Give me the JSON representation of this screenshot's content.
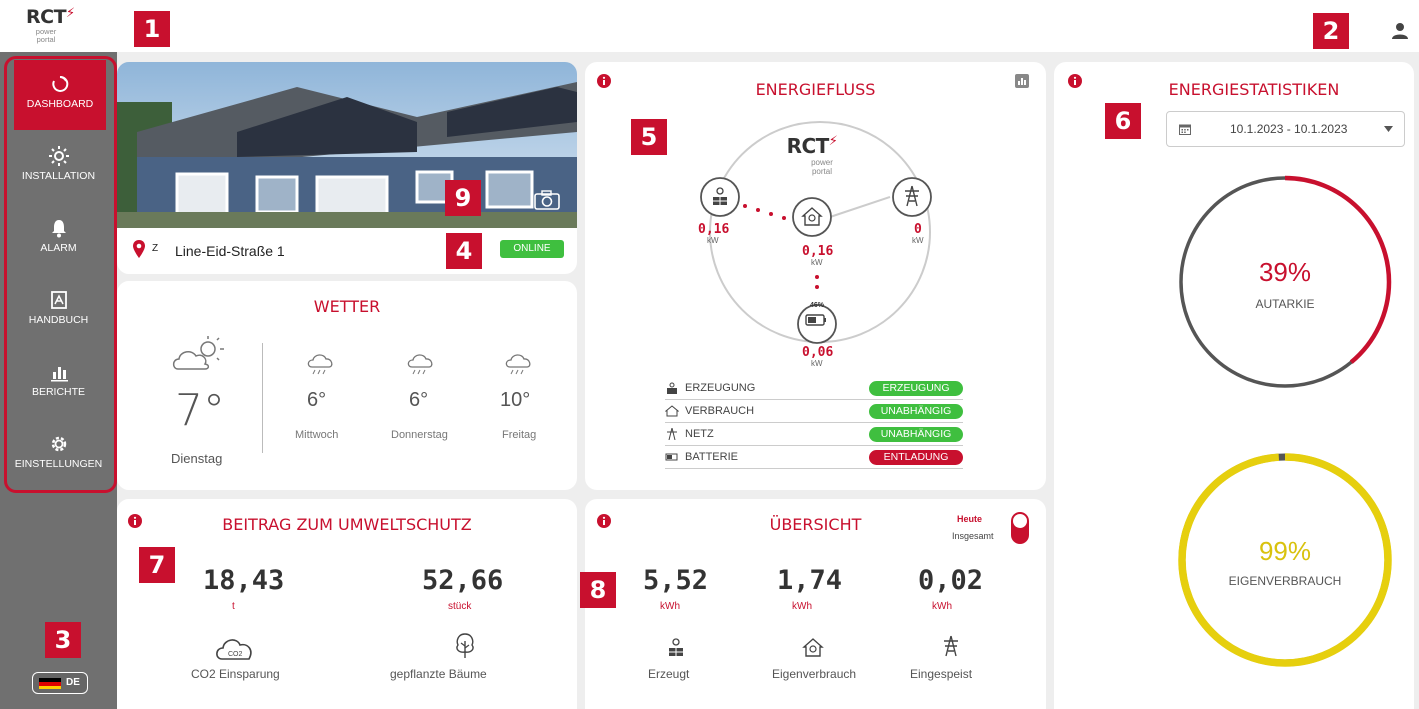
{
  "header": {
    "logo": {
      "brand": "RCT",
      "sub1": "power",
      "sub2": "portal"
    }
  },
  "badges": {
    "b1": "1",
    "b2": "2",
    "b3": "3",
    "b4": "4",
    "b5": "5",
    "b6": "6",
    "b7": "7",
    "b8": "8",
    "b9": "9"
  },
  "sidebar": {
    "items": [
      {
        "label": "DASHBOARD",
        "icon": "dashboard-icon"
      },
      {
        "label": "INSTALLATION",
        "icon": "sun-icon"
      },
      {
        "label": "ALARM",
        "icon": "bell-icon"
      },
      {
        "label": "HANDBUCH",
        "icon": "pdf-icon"
      },
      {
        "label": "BERICHTE",
        "icon": "chart-icon"
      },
      {
        "label": "EINSTELLUNGEN",
        "icon": "gear-icon"
      }
    ],
    "language": "DE"
  },
  "installation": {
    "address_prefix": "Z",
    "address": "Line-Eid-Straße 1",
    "status": "ONLINE"
  },
  "weather": {
    "title": "WETTER",
    "today": {
      "temp": "7°",
      "day": "Dienstag"
    },
    "forecast": [
      {
        "temp": "6°",
        "day": "Mittwoch"
      },
      {
        "temp": "6°",
        "day": "Donnerstag"
      },
      {
        "temp": "10°",
        "day": "Freitag"
      }
    ]
  },
  "energyflow": {
    "title": "ENERGIEFLUSS",
    "logo": {
      "brand": "RCT",
      "sub1": "power",
      "sub2": "portal"
    },
    "pv": {
      "value": "0,16",
      "unit": "kW"
    },
    "house": {
      "value": "0,16",
      "unit": "kW"
    },
    "grid": {
      "value": "0",
      "unit": "kW"
    },
    "battery": {
      "soc": "46%",
      "value": "0,06",
      "unit": "kW"
    },
    "rows": [
      {
        "name": "ERZEUGUNG",
        "status": "ERZEUGUNG",
        "color": "#3fbf3f"
      },
      {
        "name": "VERBRAUCH",
        "status": "UNABHÄNGIG",
        "color": "#3fbf3f"
      },
      {
        "name": "NETZ",
        "status": "UNABHÄNGIG",
        "color": "#3fbf3f"
      },
      {
        "name": "BATTERIE",
        "status": "ENTLADUNG",
        "color": "#c8102e"
      }
    ]
  },
  "stats": {
    "title": "ENERGIESTATISTIKEN",
    "date_range": "10.1.2023 - 10.1.2023",
    "autarkie": {
      "percent": "39%",
      "label": "AUTARKIE",
      "value": 0.39
    },
    "eigenverbrauch": {
      "percent": "99%",
      "label": "EIGENVERBRAUCH",
      "value": 0.99
    }
  },
  "environment": {
    "title": "BEITRAG ZUM UMWELTSCHUTZ",
    "co2": {
      "value": "18,43",
      "unit": "t",
      "label": "CO2 Einsparung",
      "icon_text": "CO2"
    },
    "trees": {
      "value": "52,66",
      "unit": "stück",
      "label": "gepflanzte Bäume"
    }
  },
  "overview": {
    "title": "ÜBERSICHT",
    "toggle": {
      "top": "Heute",
      "bottom": "Insgesamt"
    },
    "produced": {
      "value": "5,52",
      "unit": "kWh",
      "label": "Erzeugt"
    },
    "self": {
      "value": "1,74",
      "unit": "kWh",
      "label": "Eigenverbrauch"
    },
    "fed": {
      "value": "0,02",
      "unit": "kWh",
      "label": "Eingespeist"
    }
  },
  "colors": {
    "accent": "#c8102e",
    "green": "#3fbf3f",
    "sidebar": "#707070",
    "yellow": "#e6cf0e"
  }
}
